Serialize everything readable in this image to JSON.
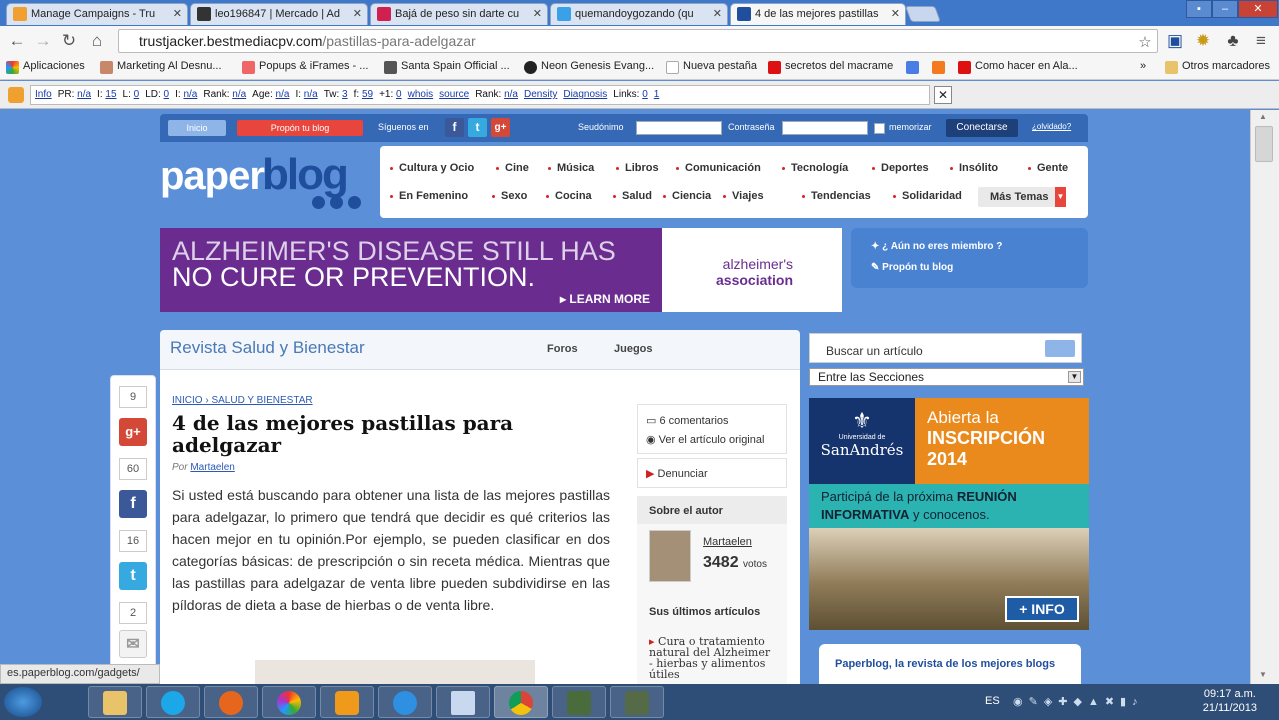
{
  "browser": {
    "tabs": [
      {
        "title": "Manage Campaigns - Tru",
        "color": "#f0a030"
      },
      {
        "title": "leo196847 | Mercado | Ad",
        "color": "#333333"
      },
      {
        "title": "Bajá de peso sin darte cu",
        "color": "#d02050"
      },
      {
        "title": "quemandoygozando (qu",
        "color": "#3aa0e8"
      },
      {
        "title": "4 de las mejores pastillas",
        "color": "#1f4e9c"
      }
    ],
    "url_host": "trustjacker.bestmediacpv.com",
    "url_path": "/pastillas-para-adelgazar",
    "bookmarks": [
      "Aplicaciones",
      "Marketing Al Desnu...",
      "Popups & iFrames - ...",
      "Santa Spain Official ...",
      "Neon Genesis Evang...",
      "Nueva pestaña",
      "secretos del macrame",
      "",
      "",
      "Como hacer en Ala..."
    ],
    "bookmarks_more": "»",
    "other_bookmarks": "Otros marcadores",
    "seo": [
      {
        "label": "Info",
        "link": true
      },
      {
        "label": "PR:",
        "value": "n/a"
      },
      {
        "label": "I:",
        "value": "15"
      },
      {
        "label": "L:",
        "value": "0"
      },
      {
        "label": "LD:",
        "value": "0"
      },
      {
        "label": "I:",
        "value": "n/a"
      },
      {
        "label": "Rank:",
        "value": "n/a"
      },
      {
        "label": "Age:",
        "value": "n/a"
      },
      {
        "label": "I:",
        "value": "n/a"
      },
      {
        "label": "Tw:",
        "value": "3"
      },
      {
        "label": "f:",
        "value": "59"
      },
      {
        "label": "+1:",
        "value": "0"
      },
      {
        "label": "whois",
        "link": true
      },
      {
        "label": "source",
        "link": true
      },
      {
        "label": "Rank:",
        "value": "n/a"
      },
      {
        "label": "Density",
        "link": true
      },
      {
        "label": "Diagnosis",
        "link": true
      },
      {
        "label": "Links:",
        "value": "0"
      },
      {
        "label": "1",
        "link": true
      }
    ]
  },
  "site": {
    "topbar": {
      "inicio": "Inicio",
      "propon": "Propón tu blog",
      "siguenos": "Síguenos en",
      "seudonimo": "Seudónimo",
      "contrasena": "Contraseña",
      "memorizar": "memorizar",
      "conectarse": "Conectarse",
      "olvidado": "¿olvidado?"
    },
    "logo": {
      "part1": "paper",
      "part2": "blog"
    },
    "categories_row1": [
      "Cultura y Ocio",
      "Cine",
      "Música",
      "Libros",
      "Comunicación",
      "Tecnología",
      "Deportes",
      "Insólito",
      "Gente"
    ],
    "categories_row2": [
      "En Femenino",
      "Sexo",
      "Cocina",
      "Salud",
      "Ciencia",
      "Viajes",
      "Tendencias",
      "Solidaridad"
    ],
    "mas_temas": "Más Temas",
    "ad": {
      "line1": "ALZHEIMER'S DISEASE STILL HAS",
      "line2": "NO CURE OR PREVENTION.",
      "cta": "▸ LEARN MORE",
      "brand1": "alzheimer's",
      "brand2": "association"
    },
    "member": {
      "q": "¿ Aún no eres miembro ?",
      "propon": "Propón tu blog"
    },
    "revista": {
      "title": "Revista Salud y Bienestar",
      "foros": "Foros",
      "juegos": "Juegos"
    },
    "share": {
      "gplus_count": "9",
      "fb_count": "60",
      "tw_count": "16",
      "mail_count": "2"
    },
    "article": {
      "crumb": "INICIO › SALUD Y BIENESTAR",
      "title": "4 de las mejores pastillas para adelgazar",
      "by": "Por",
      "author": "Martaelen",
      "body": "Si usted está buscando para obtener una lista de las mejores pastillas para adelgazar, lo primero que tendrá que decidir es qué criterios las hacen mejor en tu opinión.Por ejemplo, se pueden clasificar en dos categorías básicas: de prescripción o sin receta médica. Mientras que las pastillas para adelgazar de venta libre pueden subdividirse en las píldoras de dieta a base de hierbas o de venta libre."
    },
    "aside": {
      "comments": "6 comentarios",
      "original": "Ver el artículo original",
      "denunciar": "Denunciar",
      "sobre": "Sobre el autor",
      "author": "Martaelen",
      "votes": "3482",
      "votos_label": "votos",
      "ultimos": "Sus últimos artículos",
      "latest": "Cura o tratamiento natural del Alzheimer - hierbas y alimentos útiles"
    },
    "sidebar": {
      "search_placeholder": "Buscar un artículo",
      "sections": "Entre las Secciones",
      "banner_univ": "SanAndrés",
      "banner_univ_small": "Universidad de",
      "banner_title1": "Abierta la",
      "banner_title2": "INSCRIPCIÓN",
      "banner_title3": "2014",
      "banner_sub1": "Participá de la próxima",
      "banner_sub1b": "REUNIÓN",
      "banner_sub2b": "INFORMATIVA",
      "banner_sub2": "y conocenos.",
      "info": "+ INFO",
      "paperblog_box": "Paperblog, la revista de los mejores blogs"
    },
    "status_url": "es.paperblog.com/gadgets/"
  },
  "taskbar": {
    "lang": "ES",
    "time": "09:17 a.m.",
    "date": "21/11/2013"
  }
}
